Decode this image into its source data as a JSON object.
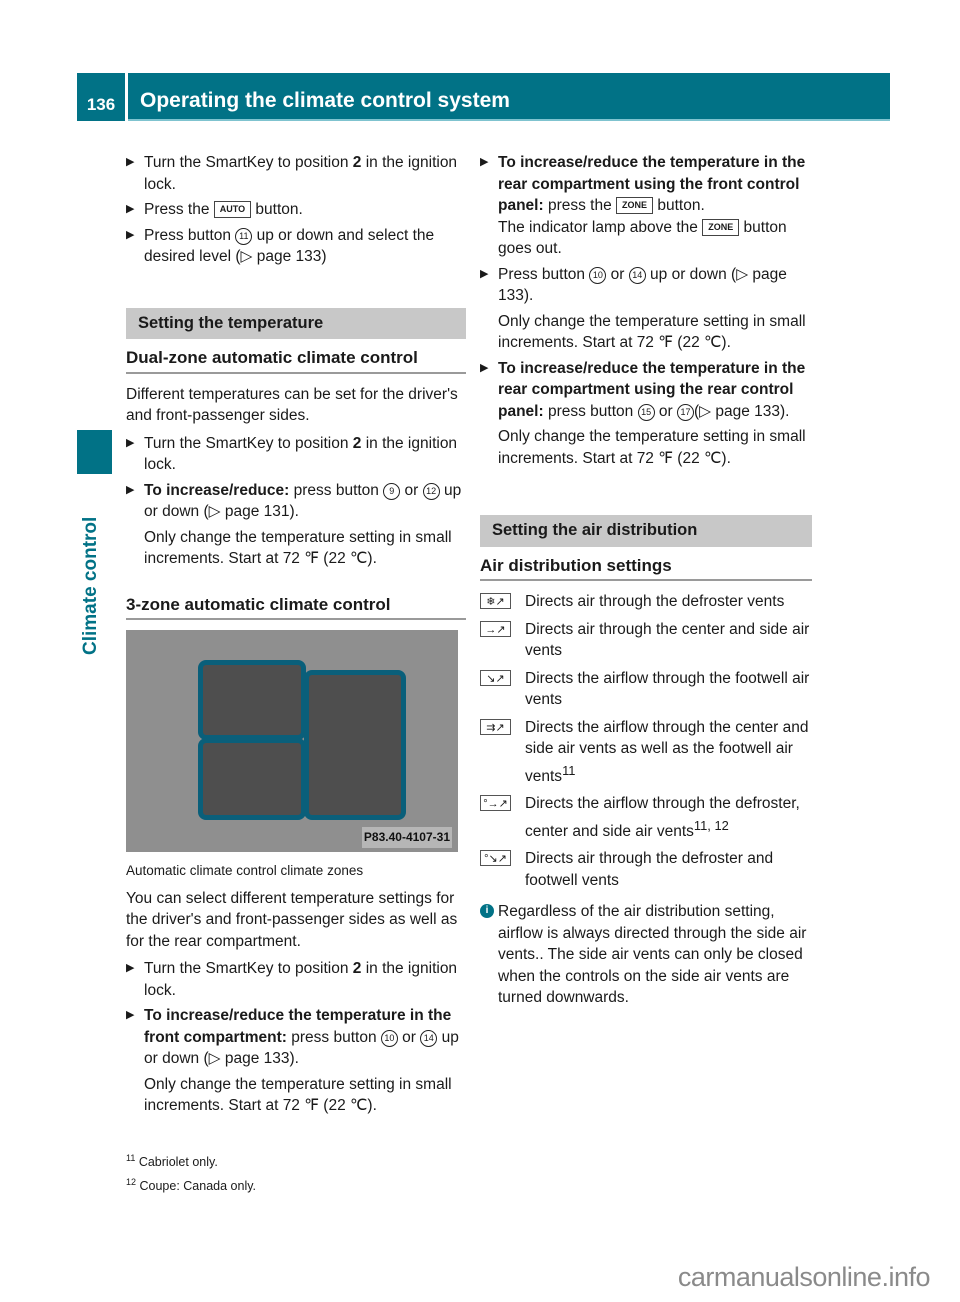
{
  "header": {
    "page_number": "136",
    "title": "Operating the climate control system",
    "color": "#017286"
  },
  "side_tab": {
    "label": "Climate control"
  },
  "left_column": {
    "intro_steps": [
      {
        "text_a": "Turn the SmartKey to position ",
        "bold": "2",
        "text_b": " in the ignition lock."
      },
      {
        "text_a": "Press the ",
        "key": "AUTO",
        "text_b": " button."
      },
      {
        "text_a": "Press button ",
        "circle": "11",
        "text_b": " up or down and select the desired level (▷ page 133)"
      }
    ],
    "section_title": "Setting the temperature",
    "dual_zone": {
      "title": "Dual-zone automatic climate control",
      "intro": "Different temperatures can be set for the driver's and front-passenger sides.",
      "step1": {
        "text_a": "Turn the SmartKey to position ",
        "bold": "2",
        "text_b": " in the ignition lock."
      },
      "step2": {
        "bold": "To increase/reduce:",
        "text_a": " press button ",
        "circle_a": "9",
        "text_b": " or ",
        "circle_b": "12",
        "text_c": " up or down (▷ page 131)."
      },
      "note": "Only change the temperature setting in small increments. Start at 72 ℉ (22 ℃)."
    },
    "three_zone": {
      "title": "3-zone automatic climate control",
      "figure_code": "P83.40-4107-31",
      "caption": "Automatic climate control climate zones",
      "intro": "You can select different temperature settings for the driver's and front-passenger sides as well as for the rear compartment.",
      "step1": {
        "text_a": "Turn the SmartKey to position ",
        "bold": "2",
        "text_b": " in the ignition lock."
      },
      "step2": {
        "bold": "To increase/reduce the temperature in the front compartment:",
        "text_a": " press button ",
        "circle_a": "10",
        "text_b": " or ",
        "circle_b": "14",
        "text_c": " up or down (▷ page 133)."
      },
      "note": "Only change the temperature setting in small increments. Start at 72 ℉ (22 ℃)."
    }
  },
  "right_column": {
    "rear_front_panel": {
      "bold": "To increase/reduce the temperature in the rear compartment using the front control panel:",
      "text_a": " press the ",
      "key": "ZONE",
      "text_b": " button.",
      "line2_a": "The indicator lamp above the ",
      "line2_b": " button goes out."
    },
    "press_step": {
      "text_a": "Press button ",
      "circle_a": "10",
      "text_b": " or ",
      "circle_b": "14",
      "text_c": " up or down (▷ page 133).",
      "note": "Only change the temperature setting in small increments. Start at 72 ℉ (22 ℃)."
    },
    "rear_rear_panel": {
      "bold": "To increase/reduce the temperature in the rear compartment using the rear control panel:",
      "text_a": " press button ",
      "circle_a": "15",
      "text_b": " or ",
      "circle_b": "17",
      "text_c": "(▷ page 133).",
      "note": "Only change the temperature setting in small increments. Start at 72 ℉ (22 ℃)."
    },
    "section_title": "Setting the air distribution",
    "subsection_title": "Air distribution settings",
    "air_settings": [
      {
        "icon": "defroster-vents-icon",
        "glyph": "❄↗",
        "text": "Directs air through the defroster vents",
        "sup": ""
      },
      {
        "icon": "center-side-vents-icon",
        "glyph": "→↗",
        "text": "Directs air through the center and side air vents",
        "sup": ""
      },
      {
        "icon": "footwell-vents-icon",
        "glyph": "↘↗",
        "text": "Directs the airflow through the footwell air vents",
        "sup": ""
      },
      {
        "icon": "center-side-footwell-vents-icon",
        "glyph": "⇉↗",
        "text": "Directs the airflow through the center and side air vents as well as the footwell air vents",
        "sup": "11"
      },
      {
        "icon": "defroster-center-side-vents-icon",
        "glyph": "°→↗",
        "text": "Directs the airflow through the defroster, center and side air vents",
        "sup": "11, 12"
      },
      {
        "icon": "defroster-footwell-vents-icon",
        "glyph": "°↘↗",
        "text": "Directs air through the defroster and footwell vents",
        "sup": ""
      }
    ],
    "info_note": "Regardless of the air distribution setting, airflow is always directed through the side air vents.. The side air vents can only be closed when the controls on the side air vents are turned downwards."
  },
  "footnotes": [
    {
      "num": "11",
      "text": "Cabriolet only."
    },
    {
      "num": "12",
      "text": "Coupe: Canada only."
    }
  ],
  "watermark": "carmanualsonline.info"
}
